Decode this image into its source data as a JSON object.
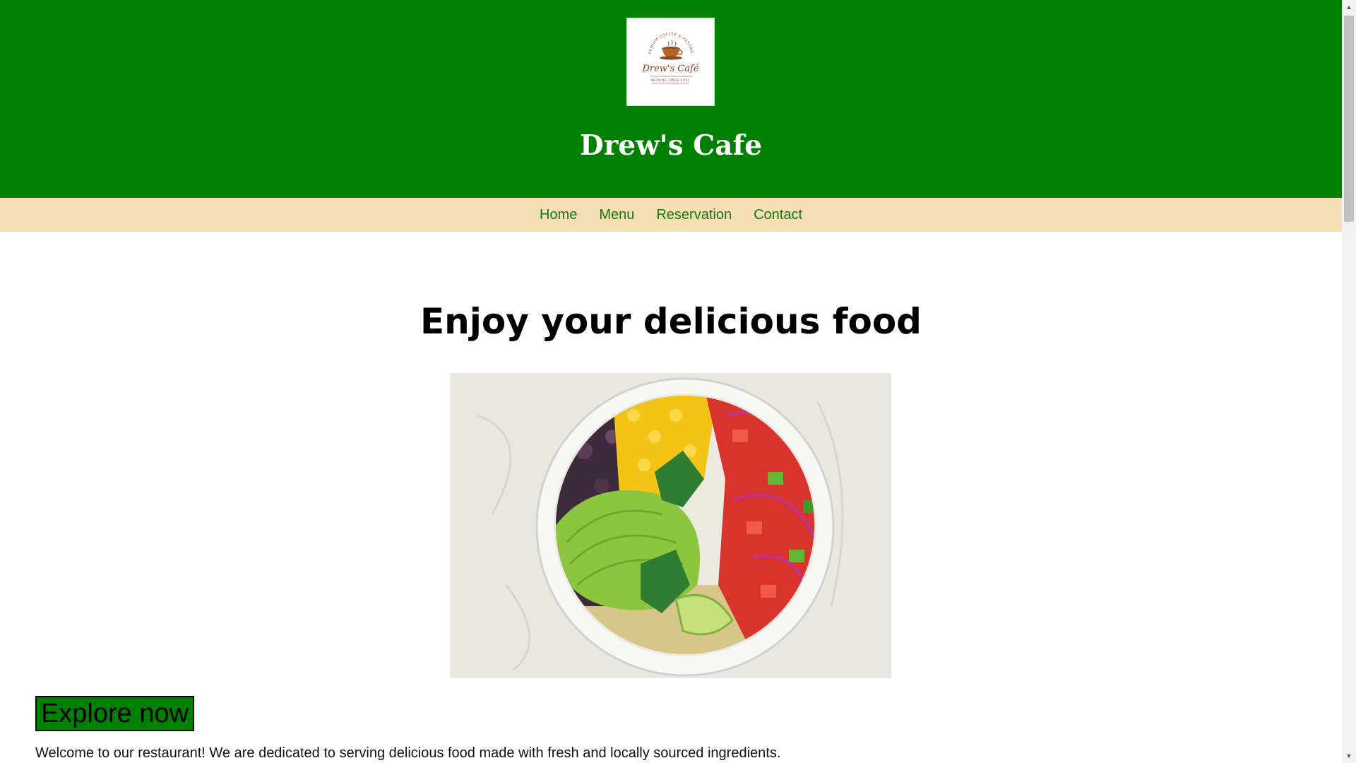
{
  "header": {
    "logo": {
      "top_text": "PREMIUM COFFEE & PASTRIES",
      "name": "Drew's Café",
      "bottom_text": "SERVING SINCE 1997"
    },
    "title": "Drew's Cafe"
  },
  "nav": {
    "items": [
      {
        "label": "Home"
      },
      {
        "label": "Menu"
      },
      {
        "label": "Reservation"
      },
      {
        "label": "Contact"
      }
    ]
  },
  "main": {
    "heading": "Enjoy your delicious food",
    "image": "food-bowl-image",
    "button_label": "Explore now",
    "intro": "Welcome to our restaurant! We are dedicated to serving delicious food made with fresh and locally sourced ingredients."
  },
  "scrollbar": {
    "up_icon": "▲",
    "down_icon": "▼"
  },
  "colors": {
    "header_bg": "#008000",
    "nav_bg": "#f5deb3",
    "nav_link": "#137a13",
    "button_bg": "#008000"
  }
}
